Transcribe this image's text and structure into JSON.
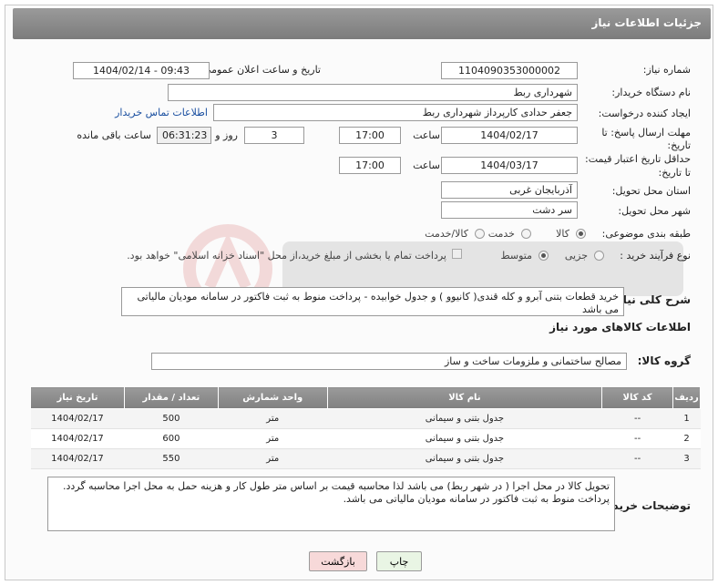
{
  "header": {
    "title": "جزئیات اطلاعات نیاز"
  },
  "fields": {
    "need_number_label": "شماره نیاز:",
    "need_number": "1104090353000002",
    "announce_label": "تاریخ و ساعت اعلان عمومی:",
    "announce_value": "1404/02/14 - 09:43",
    "buyer_org_label": "نام دستگاه خریدار:",
    "buyer_org": "شهرداری ربط",
    "creator_label": "ایجاد کننده درخواست:",
    "creator": "جعفر  حدادی کارپرداز شهرداری ربط",
    "contact_link": "اطلاعات تماس خریدار",
    "reply_deadline_label_1": "مهلت ارسال پاسخ: تا",
    "reply_deadline_label_2": "تاریخ:",
    "reply_date": "1404/02/17",
    "time_label": "ساعت",
    "reply_time": "17:00",
    "days_value": "3",
    "days_label": "روز و",
    "remaining_time": "06:31:23",
    "remaining_label": "ساعت باقی مانده",
    "price_validity_label_1": "حداقل تاریخ اعتبار قیمت:",
    "price_validity_label_2": "تا تاریخ:",
    "price_date": "1404/03/17",
    "price_time": "17:00",
    "province_label": "استان محل تحویل:",
    "province": "آذربایجان غربی",
    "city_label": "شهر محل تحویل:",
    "city": "سر دشت",
    "category_label": "طبقه بندی موضوعی:",
    "category_options": [
      "کالا",
      "خدمت",
      "کالا/خدمت"
    ],
    "purchase_type_label": "نوع فرآیند خرید :",
    "purchase_options": [
      "جزیی",
      "متوسط"
    ],
    "payment_note": "پرداخت تمام یا بخشی از مبلغ خرید،از محل \"اسناد خزانه اسلامی\" خواهد بود."
  },
  "description": {
    "label": "شرح کلی نیاز:",
    "text": "خرید قطعات بتنی آبرو و کله قندی( کانیوو )  و جدول خوابیده - پرداخت منوط به ثبت فاکتور در سامانه مودیان مالیاتی می باشد"
  },
  "goods_section": {
    "title": "اطلاعات کالاهای مورد نیاز",
    "group_label": "گروه کالا:",
    "group_value": "مصالح ساختمانی و ملزومات ساخت و ساز"
  },
  "table": {
    "headers": [
      "ردیف",
      "کد کالا",
      "نام کالا",
      "واحد شمارش",
      "تعداد / مقدار",
      "تاریخ نیاز"
    ],
    "rows": [
      [
        "1",
        "--",
        "جدول بتنی و سیمانی",
        "متر",
        "500",
        "1404/02/17"
      ],
      [
        "2",
        "--",
        "جدول بتنی و سیمانی",
        "متر",
        "600",
        "1404/02/17"
      ],
      [
        "3",
        "--",
        "جدول بتنی و سیمانی",
        "متر",
        "550",
        "1404/02/17"
      ]
    ]
  },
  "buyer_notes": {
    "label": "توضیحات خریدار:",
    "text": "تحویل کالا در محل اجرا ( در شهر ربط) می باشد لذا محاسبه قیمت بر اساس متر طول کار و هزینه حمل به محل اجرا محاسبه گردد. پرداخت منوط به ثبت فاکتور در سامانه مودیان مالیاتی می باشد."
  },
  "buttons": {
    "print": "چاپ",
    "back": "بازگشت"
  },
  "colors": {
    "header_bg": "#8a8a8a",
    "link": "#1a4fa0",
    "back_button": "#f7d9d9"
  }
}
